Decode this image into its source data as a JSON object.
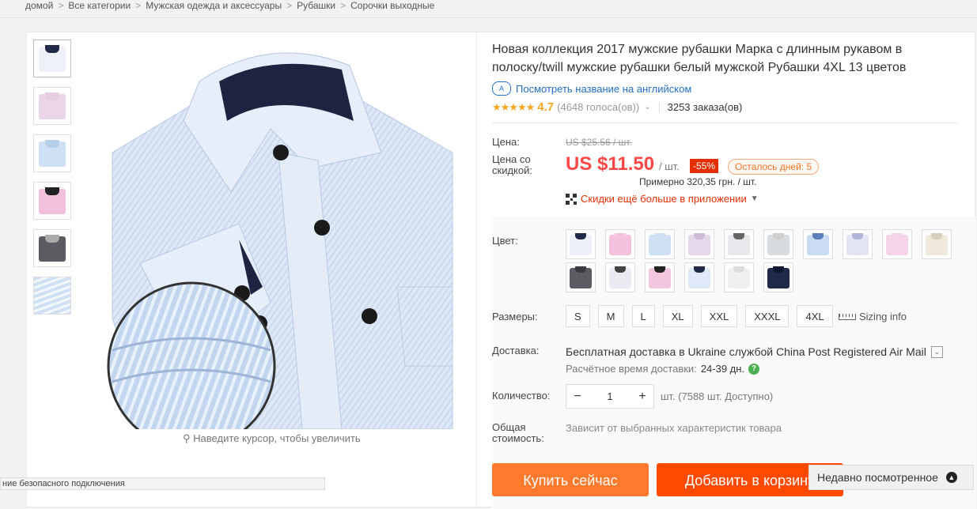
{
  "breadcrumb": [
    "домой",
    "Все категории",
    "Мужская одежда и аксессуары",
    "Рубашки",
    "Сорочки выходные"
  ],
  "gallery": {
    "zoom_hint": "Наведите курсор, чтобы увеличить",
    "thumbnails": [
      "white-shirt",
      "pink-shirt",
      "blue-shirt",
      "pink-black-shirt",
      "gray-shirt",
      "fabric-closeup"
    ]
  },
  "product": {
    "title": "Новая коллекция 2017 мужские рубашки Марка с длинным рукавом в полоску/twill мужские рубашки белый мужской Рубашки 4XL 13 цветов",
    "translate_icon": "A",
    "translate_link": "Посмотреть название на английском",
    "stars": "★★★★★",
    "rating": "4.7",
    "votes": "(4648 голоса(ов))",
    "orders": "3253 заказа(ов)"
  },
  "price": {
    "label": "Цена:",
    "old": "US $25.56 / шт.",
    "discount_label": "Цена со скидкой:",
    "current": "US $11.50",
    "unit": "/ шт.",
    "discount": "-55%",
    "days_left": "Осталось дней: 5",
    "approx": "Примерно 320,35 грн. / шт.",
    "app_promo": "Скидки ещё больше в приложении"
  },
  "color": {
    "label": "Цвет:",
    "swatches": [
      {
        "body": "#eef0f8",
        "collar": "#222a4a"
      },
      {
        "body": "#f4c2dc",
        "collar": "#f4c2dc"
      },
      {
        "body": "#cfe0f4",
        "collar": "#cfe0f4"
      },
      {
        "body": "#e6d7ea",
        "collar": "#cdbbd8"
      },
      {
        "body": "#e7e7ec",
        "collar": "#666"
      },
      {
        "body": "#d9dcdf",
        "collar": "#cfcfcf"
      },
      {
        "body": "#c9dcf2",
        "collar": "#5b7fb8"
      },
      {
        "body": "#e2e4f3",
        "collar": "#b0b6d8"
      },
      {
        "body": "#f6d3e6",
        "collar": "#f6d3e6"
      },
      {
        "body": "#efe9dc",
        "collar": "#d8cfbc"
      },
      {
        "body": "#5b5b62",
        "collar": "#3a3a40"
      },
      {
        "body": "#ebeaf0",
        "collar": "#444"
      },
      {
        "body": "#f4c6de",
        "collar": "#222"
      },
      {
        "body": "#dfe9f7",
        "collar": "#222a4a"
      },
      {
        "body": "#f0f0f2",
        "collar": "#ddd"
      },
      {
        "body": "#1f2a4a",
        "collar": "#0f1630"
      }
    ]
  },
  "sizes": {
    "label": "Размеры:",
    "options": [
      "S",
      "M",
      "L",
      "XL",
      "XXL",
      "XXXL",
      "4XL"
    ],
    "sizing_info": "Sizing info"
  },
  "shipping": {
    "label": "Доставка:",
    "text": "Бесплатная доставка в Ukraine службой China Post Registered Air Mail",
    "eta_label": "Расчётное время доставки:",
    "eta_value": "24-39 дн.",
    "help": "?"
  },
  "quantity": {
    "label": "Количество:",
    "minus": "−",
    "value": "1",
    "plus": "+",
    "available": "шт. (7588 шт. Доступно)"
  },
  "total": {
    "label": "Общая стоимость:",
    "value": "Зависит от выбранных характеристик товара"
  },
  "actions": {
    "buy_now": "Купить сейчас",
    "add_to_cart": "Добавить в корзину"
  },
  "recent": {
    "label": "Недавно посмотренное"
  },
  "status_bar": "ние безопасного подключения"
}
